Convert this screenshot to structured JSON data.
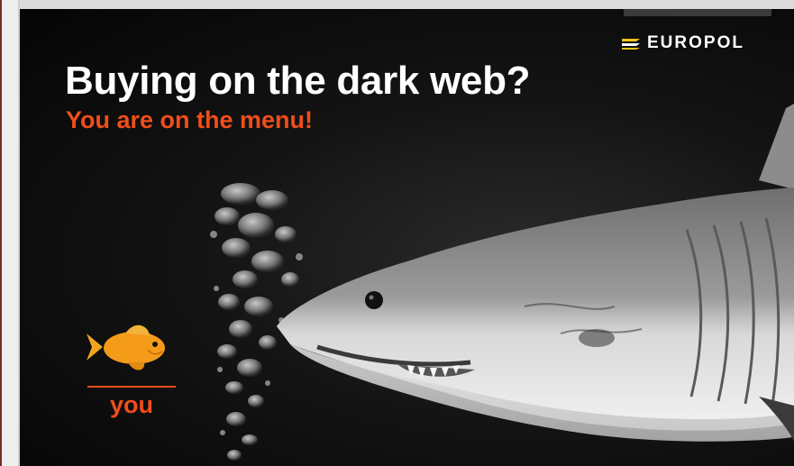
{
  "poster": {
    "headline": "Buying on the dark web?",
    "subheadline": "You are on the menu!",
    "fish_label": "you"
  },
  "logo": {
    "text": "EUROPOL",
    "icon": "europol-logo-icon"
  },
  "colors": {
    "accent": "#f04e1a",
    "background": "#0a0a0a",
    "text": "#ffffff",
    "fish": "#f59b1a"
  }
}
